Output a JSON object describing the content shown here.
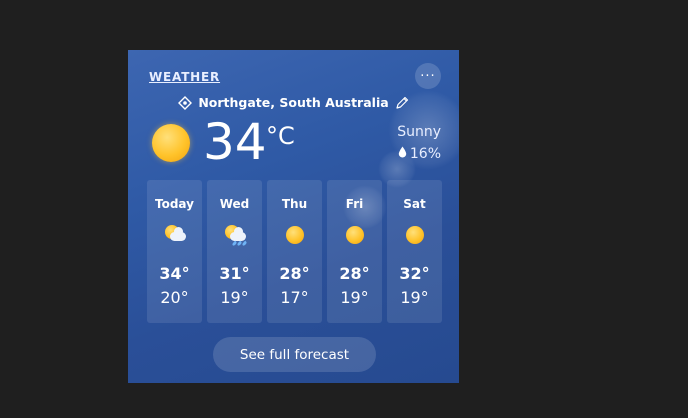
{
  "widget": {
    "title": "WEATHER",
    "more_label": "···",
    "location": "Northgate, South Australia"
  },
  "current": {
    "temperature": "34",
    "unit": "°C",
    "condition": "Sunny",
    "precipitation": "16%",
    "icon": "sun-icon"
  },
  "forecast": [
    {
      "day": "Today",
      "high": "34°",
      "low": "20°",
      "icon": "partly-cloudy-icon"
    },
    {
      "day": "Wed",
      "high": "31°",
      "low": "19°",
      "icon": "cloudy-rain-icon"
    },
    {
      "day": "Thu",
      "high": "28°",
      "low": "17°",
      "icon": "sun-icon"
    },
    {
      "day": "Fri",
      "high": "28°",
      "low": "19°",
      "icon": "sun-icon"
    },
    {
      "day": "Sat",
      "high": "32°",
      "low": "19°",
      "icon": "sun-icon"
    }
  ],
  "footer": {
    "forecast_button": "See full forecast"
  },
  "colors": {
    "background": "#1f1f1f",
    "widget_top": "#3d66b1",
    "widget_bottom": "#264a90",
    "sun": "#ffc32a"
  }
}
